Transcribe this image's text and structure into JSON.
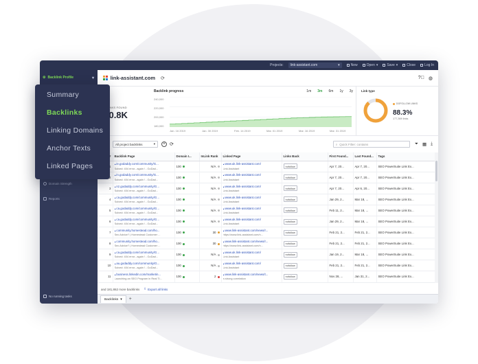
{
  "topbar": {
    "projects_label": "Projects:",
    "project_value": "link-assistant.com",
    "new": "New",
    "open": "Open",
    "save": "Save",
    "close": "Close",
    "login": "Log In"
  },
  "sidebar": {
    "header": "Backlink Profile",
    "items": [
      {
        "label": "Domain Strength"
      },
      {
        "label": "Reports"
      }
    ],
    "bottom_status": "No running tasks"
  },
  "popup_menu": {
    "items": [
      {
        "label": "Summary",
        "active": false
      },
      {
        "label": "Backlinks",
        "active": true
      },
      {
        "label": "Linking Domains",
        "active": false
      },
      {
        "label": "Anchor Texts",
        "active": false
      },
      {
        "label": "Linked Pages",
        "active": false
      }
    ]
  },
  "header": {
    "project_title": "link-assistant.com"
  },
  "stats": {
    "backlinks_found_label": "BACKLINKS FOUND",
    "backlinks_found_value": "200.8K"
  },
  "chart_data": {
    "type": "area",
    "title": "Backlink progress",
    "ranges": [
      "1m",
      "3m",
      "6m",
      "1y",
      "3y"
    ],
    "active_range": "3m",
    "y_ticks": [
      "240,000",
      "220,000",
      "200,000",
      "180,000"
    ],
    "ylim": [
      180000,
      240000
    ],
    "x_ticks": [
      "Jan. 16 2019",
      "Jan. 30 2019",
      "Feb. 14 2019",
      "Mar. 01 2019",
      "Mar. 16 2019",
      "Mar. 31 2019"
    ],
    "x": [
      "Jan. 16 2019",
      "Jan. 30 2019",
      "Feb. 14 2019",
      "Mar. 01 2019",
      "Mar. 16 2019",
      "Mar. 31 2019",
      "Apr. 08 2019"
    ],
    "values": [
      186000,
      189000,
      192000,
      195000,
      198000,
      200000,
      201000
    ],
    "colors": {
      "fill": "#c9ebc4",
      "line": "#6cc36a"
    },
    "grid": true
  },
  "link_type": {
    "title": "Link type",
    "legend": "DOFOLLOW LINKS",
    "percent": "88.3%",
    "sub": "177,369 links",
    "fraction": 0.883,
    "colors": {
      "main": "#f0a23b",
      "rest": "#e2e4ea"
    }
  },
  "filter": {
    "select_value": "All project backlinks",
    "search_placeholder": "Quick Filter: contains"
  },
  "table": {
    "columns": [
      "#",
      "Backlink Page",
      "Domain I...",
      "InLink Rank",
      "Linked Page",
      "Links Back",
      "First Found...",
      "Last Found...",
      "Tags"
    ],
    "rows": [
      {
        "n": "1",
        "page1": "ie.godaddy.com/community/G...",
        "page2": "Solved: 404 error...again ! - GoDad...",
        "domain": "100",
        "inlink": "N/A",
        "idot": "n",
        "linked1": "www.uk.link-assistant.com/",
        "linked2": "Link Assistant",
        "back": "nofollow",
        "first": "Apr 7, 20...",
        "last": "Apr 7, 20...",
        "tags": "SEO PowerSuite Link Ex..."
      },
      {
        "n": "2",
        "page1": "in.godaddy.com/community/G...",
        "page2": "Solved: 404 error...again ! - GoDad...",
        "domain": "100",
        "inlink": "N/A",
        "idot": "n",
        "linked1": "www.uk.link-assistant.com/",
        "linked2": "Link Assistant",
        "back": "nofollow",
        "first": "Apr 7, 20...",
        "last": "Apr 7, 20...",
        "tags": "SEO PowerSuite Link Ex..."
      },
      {
        "n": "3",
        "page1": "nz.godaddy.com/community/G...",
        "page2": "Solved: 404 error...again ! - GoDad...",
        "domain": "100",
        "inlink": "N/A",
        "idot": "n",
        "linked1": "www.uk.link-assistant.com/",
        "linked2": "Link Assistant",
        "back": "nofollow",
        "first": "Apr 7, 20...",
        "last": "Apr 6, 20...",
        "tags": "SEO PowerSuite Link Ex..."
      },
      {
        "n": "4",
        "page1": "ca.godaddy.com/community/G...",
        "page2": "Solved: 404 error...again ! - GoDad...",
        "domain": "100",
        "inlink": "N/A",
        "idot": "n",
        "linked1": "www.uk.link-assistant.com/",
        "linked2": "Link Assistant",
        "back": "nofollow",
        "first": "Jan 29, 2...",
        "last": "Mar 18, ...",
        "tags": "SEO PowerSuite Link Ex..."
      },
      {
        "n": "5",
        "page1": "ca.godaddy.com/community/G...",
        "page2": "Solved: 404 error...again ! - GoDad...",
        "domain": "100",
        "inlink": "N/A",
        "idot": "n",
        "linked1": "www.uk.link-assistant.com/",
        "linked2": "Link Assistant",
        "back": "nofollow",
        "first": "Feb 11, 2...",
        "last": "Mar 18, ...",
        "tags": "SEO PowerSuite Link Ex..."
      },
      {
        "n": "6",
        "page1": "ca.godaddy.com/community/G...",
        "page2": "Solved: 404 error...again ! - GoDad...",
        "domain": "100",
        "inlink": "N/A",
        "idot": "n",
        "linked1": "www.uk.link-assistant.com/",
        "linked2": "Link Assistant",
        "back": "nofollow",
        "first": "Jan 29, 2...",
        "last": "Mar 18, ...",
        "tags": "SEO PowerSuite Link Ex..."
      },
      {
        "n": "7",
        "page1": "community.homestead.com/ho...",
        "page2": "Seo Advice? | Homestead Customer ...",
        "domain": "100",
        "inlink": "30",
        "idot": "o",
        "linked1": "www.link-assistant.com/news/r...",
        "linked2": "https://www.link-assistant.com/n...",
        "back": "nofollow",
        "first": "Feb 21, 2...",
        "last": "Feb 21, 2...",
        "tags": "SEO PowerSuite Link Ex..."
      },
      {
        "n": "8",
        "page1": "community.homestead.com/ho...",
        "page2": "Seo Advice? | Homestead Customer ...",
        "domain": "100",
        "inlink": "30",
        "idot": "o",
        "linked1": "www.link-assistant.com/news/r...",
        "linked2": "https://www.link-assistant.com/n...",
        "back": "nofollow",
        "first": "Feb 21, 2...",
        "last": "Feb 21, 2...",
        "tags": "SEO PowerSuite Link Ex..."
      },
      {
        "n": "9",
        "page1": "ca.godaddy.com/community/G...",
        "page2": "Solved: 404 error...again ! - GoDad...",
        "domain": "100",
        "inlink": "N/A",
        "idot": "n",
        "linked1": "www.uk.link-assistant.com/",
        "linked2": "Link Assistant",
        "back": "nofollow",
        "first": "Jan 19, 2...",
        "last": "Mar 18, ...",
        "tags": "SEO PowerSuite Link Ex..."
      },
      {
        "n": "10",
        "page1": "au.godaddy.com/community/G...",
        "page2": "Solved: 404 error...again ! - GoDad...",
        "domain": "100",
        "inlink": "N/A",
        "idot": "n",
        "linked1": "www.uk.link-assistant.com/",
        "linked2": "Link Assistant",
        "back": "nofollow",
        "first": "Feb 21, 2...",
        "last": "Feb 21, 2...",
        "tags": "SEO PowerSuite Link Ex..."
      },
      {
        "n": "11",
        "page1": "business.linkedin.com/marketin...",
        "page2": "Launching an SEO Program in Real Ti...",
        "domain": "100",
        "inlink": "2",
        "idot": "r",
        "linked1": "www.link-assistant.com/news/t...",
        "linked2": "a strong correlation",
        "back": "nofollow",
        "first": "Nov 28, ...",
        "last": "Jan 31, 2...",
        "tags": "SEO PowerSuite Link Ex..."
      }
    ]
  },
  "footer": {
    "more_text": "and 181,862 more backlinks",
    "export_label": "Export all links"
  },
  "tabs": {
    "active": "Backlinks"
  }
}
